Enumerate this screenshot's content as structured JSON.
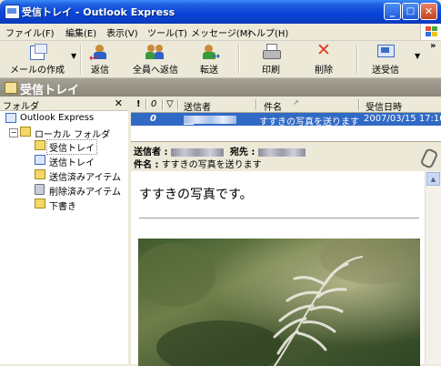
{
  "window": {
    "title": "受信トレイ - Outlook Express",
    "minimize": "_",
    "maximize": "□",
    "close": "✕"
  },
  "menu": [
    "ファイル(F)",
    "編集(E)",
    "表示(V)",
    "ツール(T)",
    "メッセージ(M)",
    "ヘルプ(H)"
  ],
  "toolbar": {
    "compose": "メールの作成",
    "reply": "返信",
    "reply_all": "全員へ返信",
    "forward": "転送",
    "print": "印刷",
    "delete": "削除",
    "send_receive": "送受信",
    "more": "»"
  },
  "folder_bar": {
    "title": "受信トレイ"
  },
  "folders_pane": {
    "header": "フォルダ",
    "close": "✕",
    "items": [
      {
        "label": "Outlook Express",
        "icon": "outlook-express-icon"
      },
      {
        "label": "ローカル フォルダ",
        "icon": "local-folders-icon"
      },
      {
        "label": "受信トレイ",
        "icon": "inbox-icon",
        "selected": true
      },
      {
        "label": "送信トレイ",
        "icon": "outbox-icon"
      },
      {
        "label": "送信済みアイテム",
        "icon": "sent-items-icon"
      },
      {
        "label": "削除済みアイテム",
        "icon": "deleted-items-icon"
      },
      {
        "label": "下書き",
        "icon": "drafts-icon"
      }
    ]
  },
  "message_list": {
    "columns": {
      "priority": "!",
      "attachment": "0",
      "flag": "▽",
      "from": "送信者",
      "subject": "件名",
      "received": "受信日時"
    },
    "rows": [
      {
        "attachment": "0",
        "subject": "すすきの写真を送ります",
        "received": "2007/03/15 17:10"
      }
    ]
  },
  "preview": {
    "from_label": "送信者 :",
    "to_label": "宛先 :",
    "subject_label": "件名 :",
    "subject": "すすきの写真を送ります",
    "body_text": "すすきの写真です。"
  },
  "colors": {
    "title_bar": "#0b45d8",
    "selection": "#316ac5",
    "chrome": "#ece9d8"
  }
}
